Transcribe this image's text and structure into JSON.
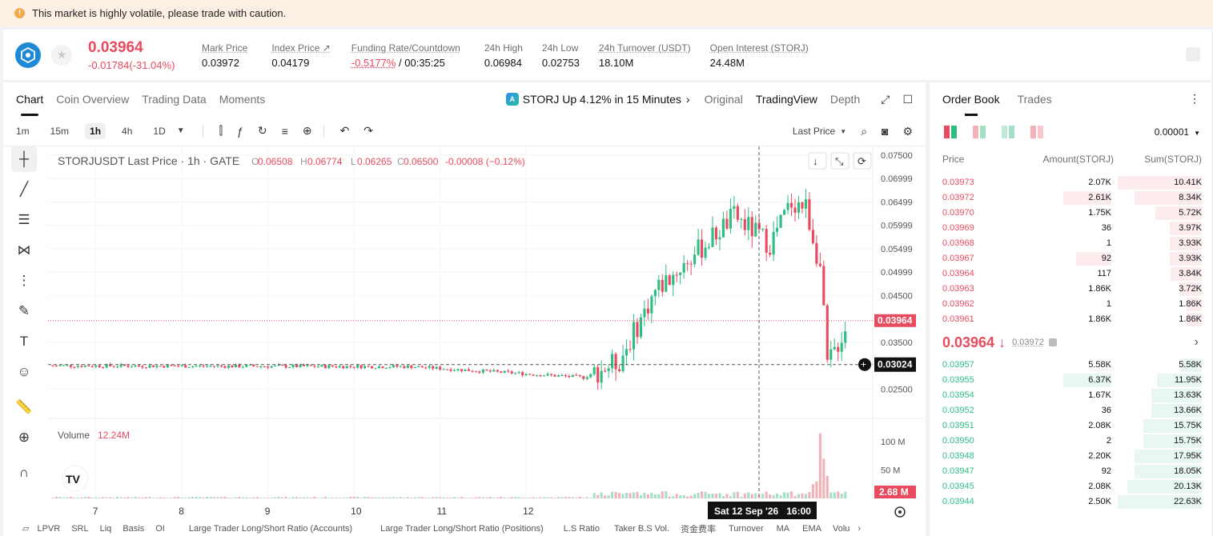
{
  "banner": {
    "message": "This market is highly volatile, please trade with caution."
  },
  "ticker": {
    "last_price": "0.03964",
    "change": "-0.01784(-31.04%)",
    "stats": [
      {
        "label": "Mark Price",
        "value": "0.03972"
      },
      {
        "label": "Index Price ↗",
        "value": "0.04179"
      },
      {
        "label": "Funding Rate/Countdown",
        "value_red": "-0.5177%",
        "value": " / 00:35:25"
      },
      {
        "label": "24h High",
        "value": "0.06984"
      },
      {
        "label": "24h Low",
        "value": "0.02753"
      },
      {
        "label": "24h Turnover (USDT)",
        "value": "18.10M"
      },
      {
        "label": "Open Interest (STORJ)",
        "value": "24.48M"
      }
    ]
  },
  "tabs": [
    "Chart",
    "Coin Overview",
    "Trading Data",
    "Moments"
  ],
  "news": "STORJ Up 4.12% in 15 Minutes",
  "view_options": [
    "Original",
    "TradingView",
    "Depth"
  ],
  "intervals": [
    "1m",
    "15m",
    "1h",
    "4h",
    "1D"
  ],
  "price_type": "Last Price",
  "legend": {
    "symbol": "STORJUSDT Last Price · 1h · GATE",
    "o_label": "O",
    "o": "0.06508",
    "h_label": "H",
    "h": "0.06774",
    "l_label": "L",
    "l": "0.06265",
    "c_label": "C",
    "c": "0.06500",
    "chg": "-0.00008 (−0.12%)"
  },
  "volume_label": "Volume",
  "volume_value": "12.24M",
  "current_price_tag": "0.03964",
  "crosshair_price_tag": "0.03024",
  "crosshair_time": "Sat 12 Sep '26   16:00",
  "volume_tag": "2.68 M",
  "chart_data": {
    "type": "candlestick",
    "symbol": "STORJUSDT",
    "interval": "1h",
    "price_axis_ticks": [
      "0.07500",
      "0.06999",
      "0.06499",
      "0.05999",
      "0.05499",
      "0.04999",
      "0.04500",
      "0.03500",
      "0.02500"
    ],
    "volume_axis_ticks": [
      "100 M",
      "50 M"
    ],
    "x_ticks": [
      "7",
      "8",
      "9",
      "10",
      "11",
      "12"
    ],
    "ylim": [
      0.0225,
      0.0755
    ],
    "segments": [
      {
        "from": 0,
        "to": 100,
        "start": 0.03,
        "end": 0.0298
      },
      {
        "from": 100,
        "to": 148,
        "start": 0.0298,
        "end": 0.0275
      },
      {
        "from": 148,
        "to": 158,
        "start": 0.0275,
        "end": 0.031
      },
      {
        "from": 158,
        "to": 168,
        "start": 0.031,
        "end": 0.046
      },
      {
        "from": 168,
        "to": 182,
        "start": 0.046,
        "end": 0.056
      },
      {
        "from": 182,
        "to": 190,
        "start": 0.056,
        "end": 0.062
      },
      {
        "from": 190,
        "to": 200,
        "start": 0.062,
        "end": 0.056
      },
      {
        "from": 200,
        "to": 206,
        "start": 0.056,
        "end": 0.065
      },
      {
        "from": 206,
        "to": 210,
        "start": 0.065,
        "end": 0.064
      },
      {
        "from": 210,
        "to": 214,
        "start": 0.064,
        "end": 0.051
      },
      {
        "from": 214,
        "to": 216,
        "start": 0.051,
        "end": 0.03
      },
      {
        "from": 216,
        "to": 222,
        "start": 0.03,
        "end": 0.0396
      }
    ]
  },
  "bottom_indicators": [
    "LPVR",
    "SRL",
    "Liq",
    "Basis",
    "OI",
    "Large Trader Long/Short Ratio (Accounts)",
    "Large Trader Long/Short Ratio (Positions)",
    "L.S Ratio",
    "Taker B.S Vol.",
    "资金费率",
    "Turnover",
    "MA",
    "EMA",
    "Volu"
  ],
  "order_book": {
    "tabs": [
      "Order Book",
      "Trades"
    ],
    "precision": "0.00001",
    "headers": [
      "Price",
      "Amount(STORJ)",
      "Sum(STORJ)"
    ],
    "asks": [
      {
        "price": "0.03973",
        "amount": "2.07K",
        "sum": "10.41K",
        "amt_frac": 0,
        "sum_frac": 1.0
      },
      {
        "price": "0.03972",
        "amount": "2.61K",
        "sum": "8.34K",
        "amt_frac": 0.54,
        "sum_frac": 0.8
      },
      {
        "price": "0.03970",
        "amount": "1.75K",
        "sum": "5.72K",
        "amt_frac": 0,
        "sum_frac": 0.55
      },
      {
        "price": "0.03969",
        "amount": "36",
        "sum": "3.97K",
        "amt_frac": 0,
        "sum_frac": 0.38
      },
      {
        "price": "0.03968",
        "amount": "1",
        "sum": "3.93K",
        "amt_frac": 0,
        "sum_frac": 0.38
      },
      {
        "price": "0.03967",
        "amount": "92",
        "sum": "3.93K",
        "amt_frac": 0.4,
        "sum_frac": 0.38
      },
      {
        "price": "0.03964",
        "amount": "117",
        "sum": "3.84K",
        "amt_frac": 0,
        "sum_frac": 0.37
      },
      {
        "price": "0.03963",
        "amount": "1.86K",
        "sum": "3.72K",
        "amt_frac": 0,
        "sum_frac": 0.26
      },
      {
        "price": "0.03962",
        "amount": "1",
        "sum": "1.86K",
        "amt_frac": 0,
        "sum_frac": 0.18
      },
      {
        "price": "0.03961",
        "amount": "1.86K",
        "sum": "1.86K",
        "amt_frac": 0,
        "sum_frac": 0.18
      }
    ],
    "mid_price": "0.03964 ↓",
    "mark_price": "0.03972",
    "bids": [
      {
        "price": "0.03957",
        "amount": "5.58K",
        "sum": "5.58K",
        "amt_frac": 0,
        "sum_frac": 0.25
      },
      {
        "price": "0.03955",
        "amount": "6.37K",
        "sum": "11.95K",
        "amt_frac": 0.54,
        "sum_frac": 0.53
      },
      {
        "price": "0.03954",
        "amount": "1.67K",
        "sum": "13.63K",
        "amt_frac": 0,
        "sum_frac": 0.6
      },
      {
        "price": "0.03952",
        "amount": "36",
        "sum": "13.66K",
        "amt_frac": 0,
        "sum_frac": 0.6
      },
      {
        "price": "0.03951",
        "amount": "2.08K",
        "sum": "15.75K",
        "amt_frac": 0,
        "sum_frac": 0.7
      },
      {
        "price": "0.03950",
        "amount": "2",
        "sum": "15.75K",
        "amt_frac": 0,
        "sum_frac": 0.7
      },
      {
        "price": "0.03948",
        "amount": "2.20K",
        "sum": "17.95K",
        "amt_frac": 0,
        "sum_frac": 0.8
      },
      {
        "price": "0.03947",
        "amount": "92",
        "sum": "18.05K",
        "amt_frac": 0,
        "sum_frac": 0.8
      },
      {
        "price": "0.03945",
        "amount": "2.08K",
        "sum": "20.13K",
        "amt_frac": 0,
        "sum_frac": 0.89
      },
      {
        "price": "0.03944",
        "amount": "2.50K",
        "sum": "22.63K",
        "amt_frac": 0,
        "sum_frac": 1.0
      }
    ]
  },
  "colors": {
    "up": "#2ebd85",
    "down": "#e84b5e",
    "banner_bg": "#fdf1e5"
  }
}
